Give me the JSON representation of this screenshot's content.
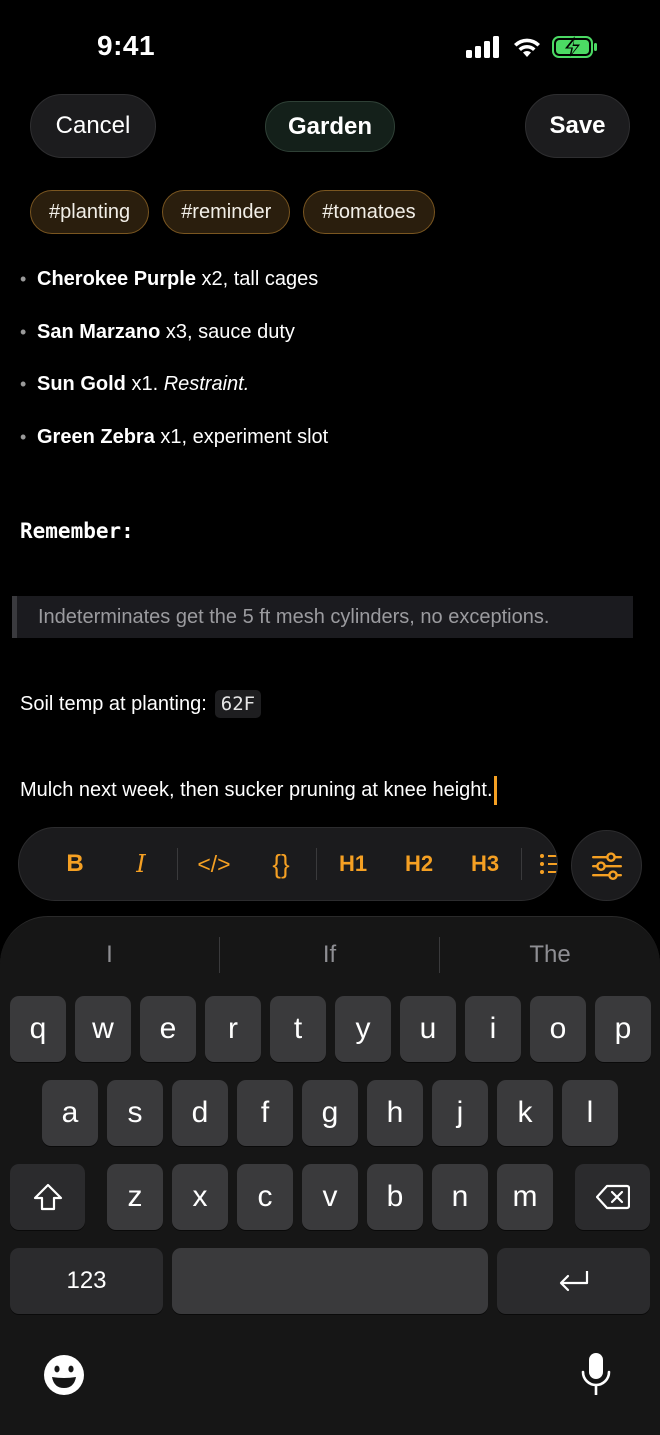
{
  "status_bar": {
    "time": "9:41"
  },
  "header": {
    "cancel_label": "Cancel",
    "title": "Garden",
    "save_label": "Save"
  },
  "tags": [
    "#planting",
    "#reminder",
    "#tomatoes"
  ],
  "note": {
    "bullets": [
      {
        "bold": "Cherokee Purple",
        "rest": " x2, tall cages",
        "italic": ""
      },
      {
        "bold": "San Marzano",
        "rest": " x3, sauce duty",
        "italic": ""
      },
      {
        "bold": "Sun Gold",
        "rest": " x1. ",
        "italic": "Restraint."
      },
      {
        "bold": "Green Zebra",
        "rest": " x1, experiment slot",
        "italic": ""
      }
    ],
    "remember": "Remember:",
    "quote": "Indeterminates get the 5 ft mesh cylinders, no exceptions.",
    "soil_label": "Soil temp at planting:",
    "soil_value": "62F",
    "last_line": "Mulch next week, then sucker pruning at knee height."
  },
  "toolbar": {
    "bold": "B",
    "italic": "I",
    "code": "</>",
    "code_block": "{}",
    "h1": "H1",
    "h2": "H2",
    "h3": "H3",
    "icons": [
      "list-icon",
      "sliders-icon"
    ]
  },
  "keyboard": {
    "suggestions": [
      "I",
      "If",
      "The"
    ],
    "row1": [
      "q",
      "w",
      "e",
      "r",
      "t",
      "y",
      "u",
      "i",
      "o",
      "p"
    ],
    "row2": [
      "a",
      "s",
      "d",
      "f",
      "g",
      "h",
      "j",
      "k",
      "l"
    ],
    "row3": [
      "z",
      "x",
      "c",
      "v",
      "b",
      "n",
      "m"
    ],
    "numbers_label": "123",
    "icons": [
      "shift-icon",
      "delete-icon",
      "return-icon",
      "emoji-icon",
      "microphone-icon"
    ]
  },
  "colors": {
    "accent": "#f5a023",
    "background": "#000000",
    "tag_border": "#7a5620"
  }
}
